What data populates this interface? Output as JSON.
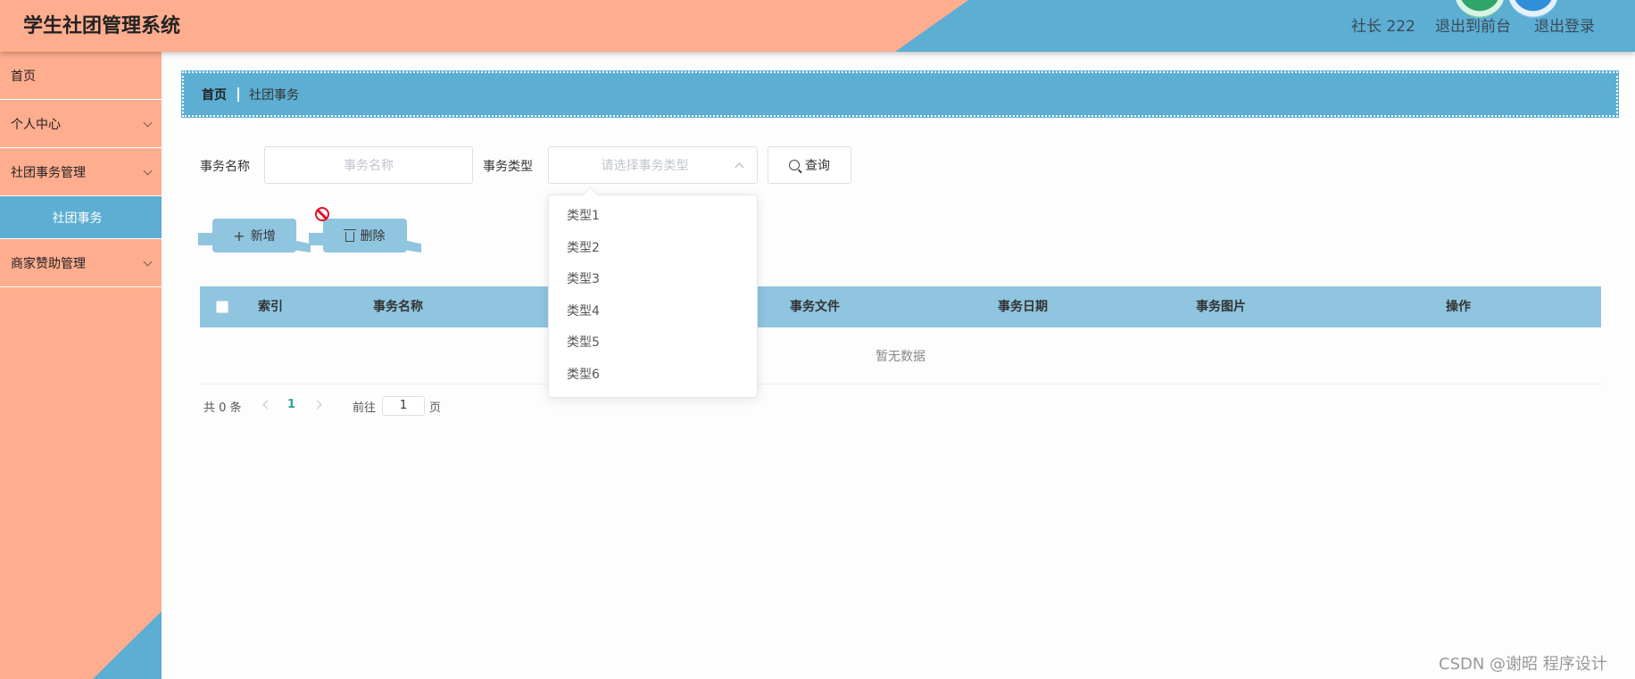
{
  "app": {
    "title": "学生社团管理系统"
  },
  "header": {
    "user_label": "社长 222",
    "front_link": "退出到前台",
    "logout_link": "退出登录"
  },
  "sidebar": {
    "items": [
      {
        "label": "首页"
      },
      {
        "label": "个人中心"
      },
      {
        "label": "社团事务管理"
      },
      {
        "label": "社团事务"
      },
      {
        "label": "商家赞助管理"
      }
    ]
  },
  "breadcrumb": {
    "home": "首页",
    "current": "社团事务"
  },
  "search": {
    "name_label": "事务名称",
    "name_placeholder": "事务名称",
    "type_label": "事务类型",
    "type_placeholder": "请选择事务类型",
    "query_button": "查询"
  },
  "dropdown": {
    "options": [
      "类型1",
      "类型2",
      "类型3",
      "类型4",
      "类型5",
      "类型6"
    ]
  },
  "actions": {
    "add_label": "新增",
    "delete_label": "删除"
  },
  "table": {
    "columns": [
      "索引",
      "事务名称",
      "事务文件",
      "事务日期",
      "事务图片",
      "操作"
    ],
    "empty_text": "暂无数据"
  },
  "pagination": {
    "total_text": "共 0 条",
    "current_page": "1",
    "goto_label": "前往",
    "goto_value": "1",
    "page_suffix": "页"
  },
  "watermark": "CSDN @谢昭  程序设计",
  "colors": {
    "salmon": "#ffad8f",
    "blue": "#5caed3",
    "light_blue": "#8fc5df",
    "page_active": "#2ba6a0"
  }
}
